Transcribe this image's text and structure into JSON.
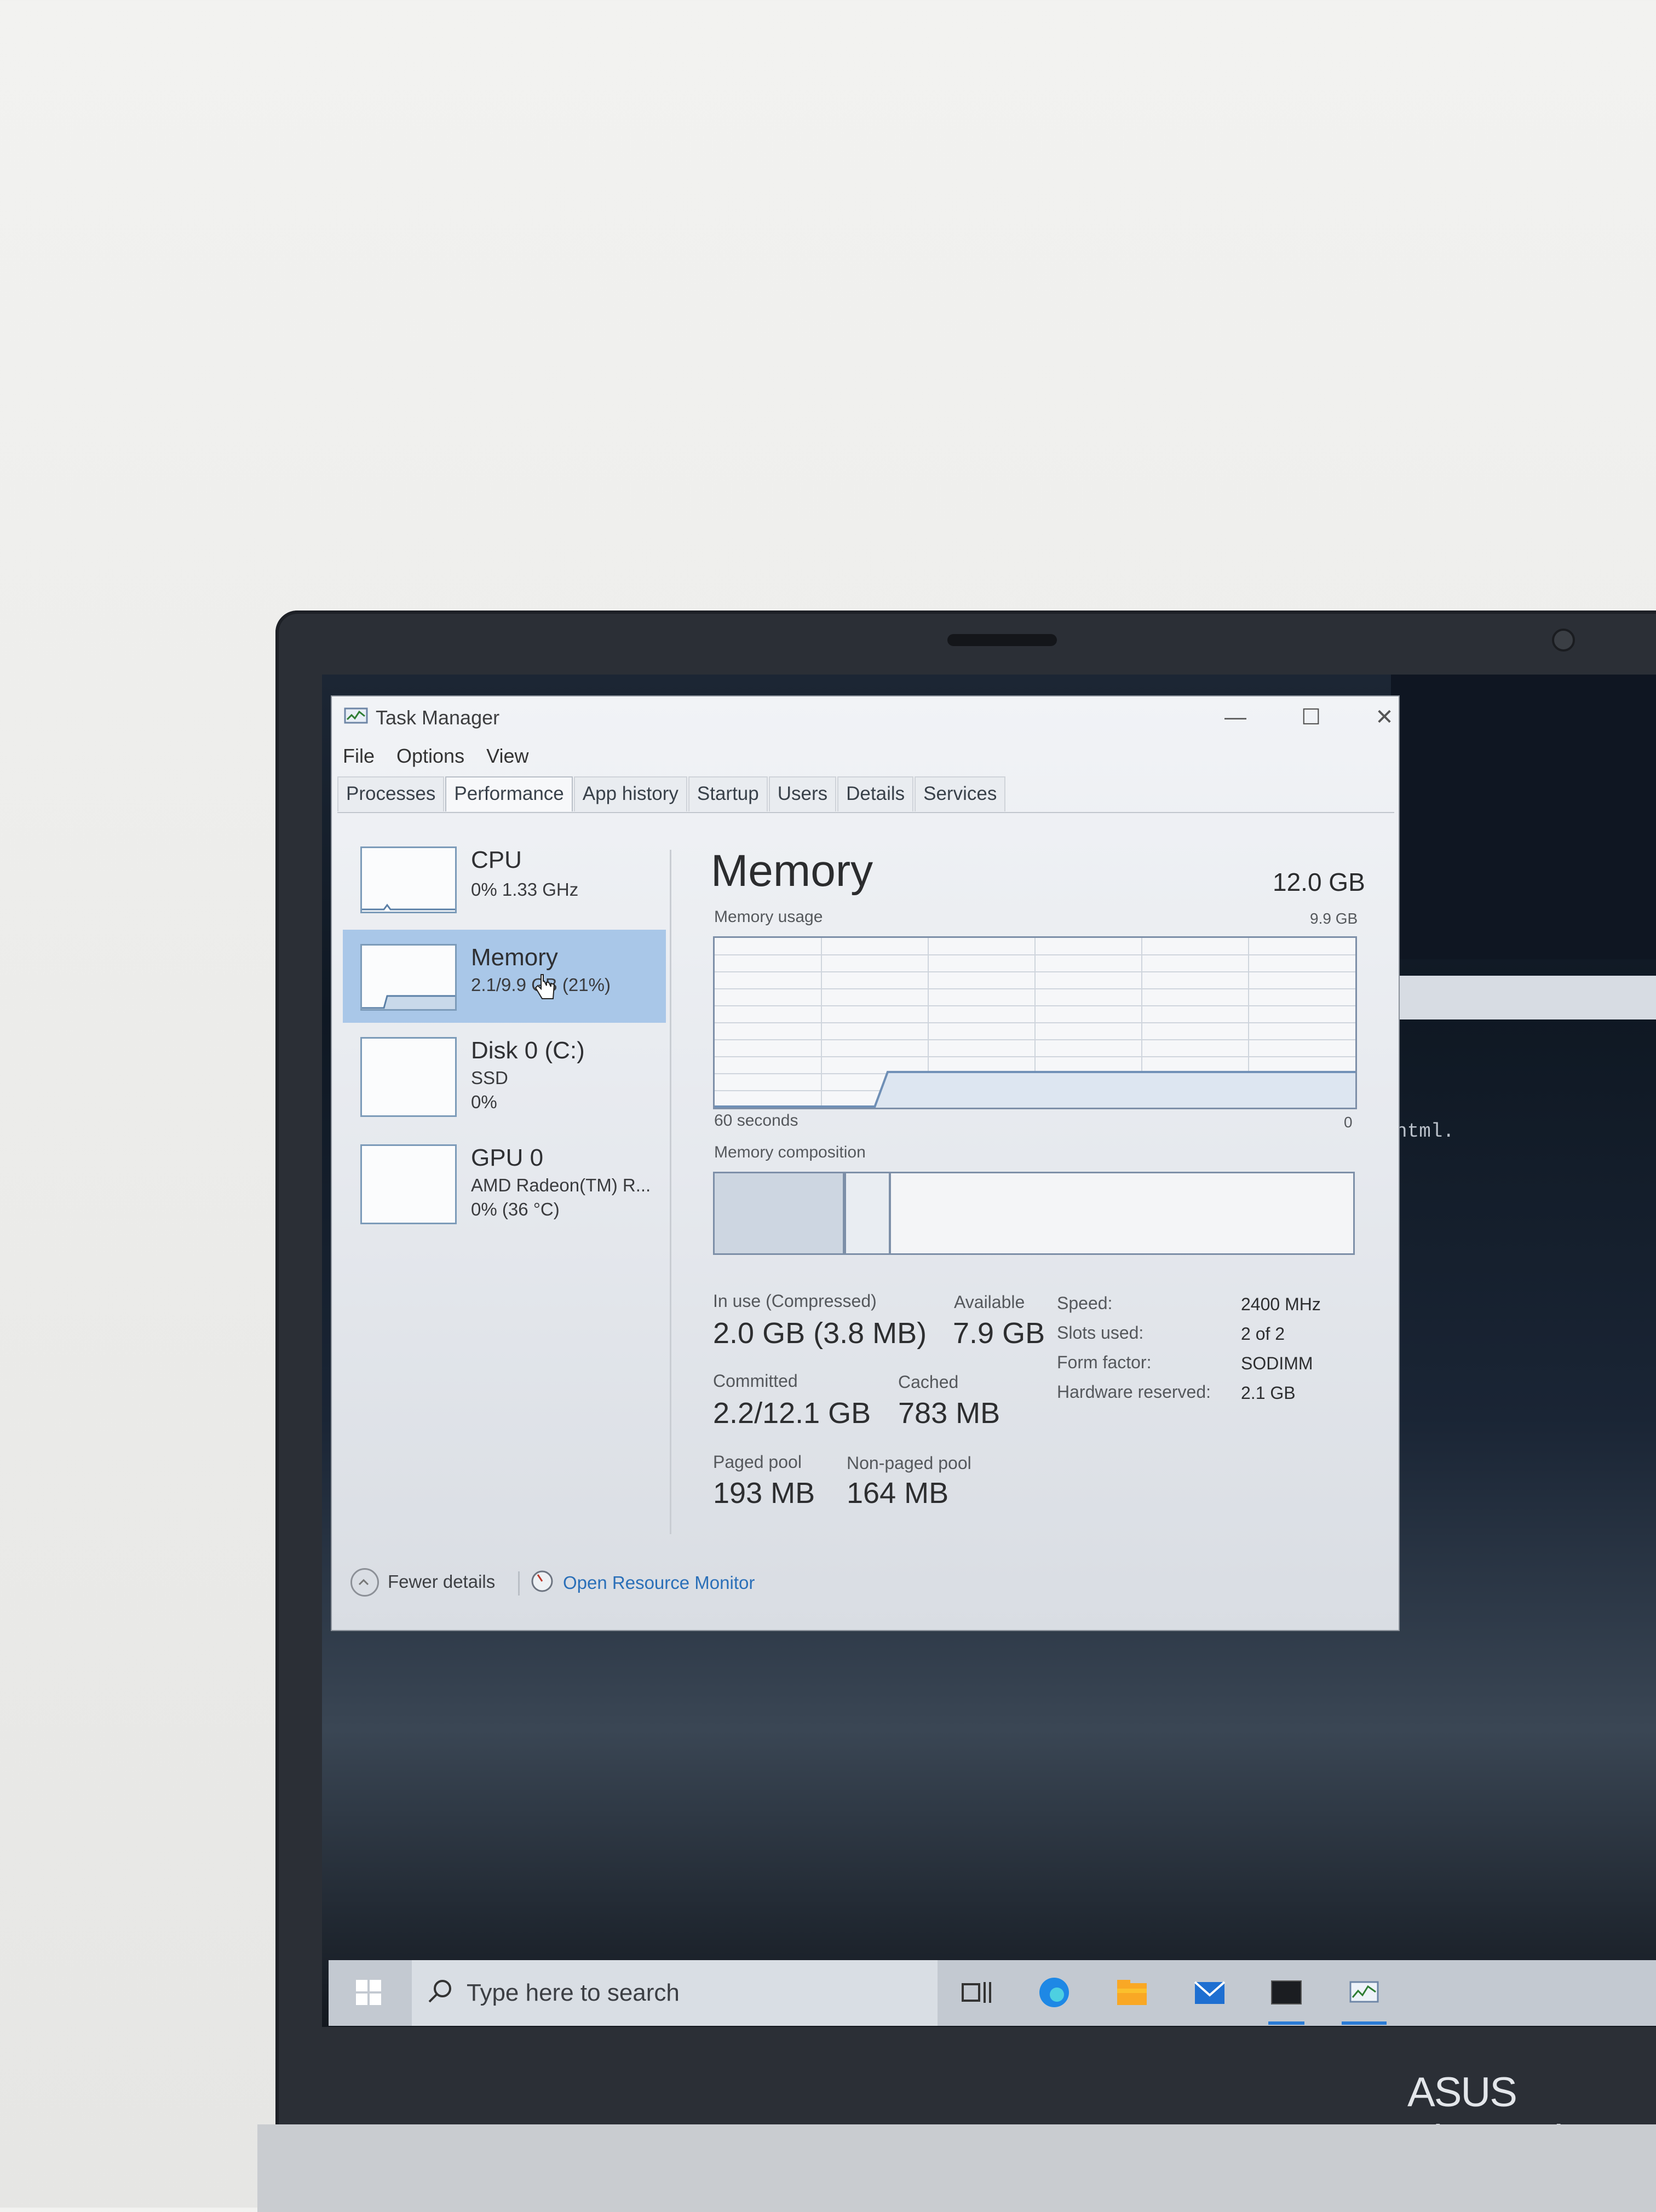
{
  "window": {
    "title": "Task Manager",
    "minimize": "—",
    "maximize": "☐",
    "close": "✕"
  },
  "menu": [
    "File",
    "Options",
    "View"
  ],
  "tabs": [
    "Processes",
    "Performance",
    "App history",
    "Startup",
    "Users",
    "Details",
    "Services"
  ],
  "active_tab": "Performance",
  "sidebar": {
    "items": [
      {
        "name": "CPU",
        "sub1": "0% 1.33 GHz",
        "sub2": "",
        "selected": false
      },
      {
        "name": "Memory",
        "sub1": "2.1/9.9 GB (21%)",
        "sub2": "",
        "selected": true
      },
      {
        "name": "Disk 0 (C:)",
        "sub1": "SSD",
        "sub2": "0%",
        "selected": false
      },
      {
        "name": "GPU 0",
        "sub1": "AMD Radeon(TM) R...",
        "sub2": "0% (36 °C)",
        "selected": false
      }
    ]
  },
  "memory": {
    "title": "Memory",
    "total": "12.0 GB",
    "usage_label": "Memory usage",
    "usage_max": "9.9 GB",
    "time_left": "60 seconds",
    "time_right": "0",
    "composition_label": "Memory composition",
    "usage_fraction": 0.21,
    "stats": {
      "in_use_label": "In use (Compressed)",
      "in_use": "2.0 GB (3.8 MB)",
      "available_label": "Available",
      "available": "7.9 GB",
      "committed_label": "Committed",
      "committed": "2.2/12.1 GB",
      "cached_label": "Cached",
      "cached": "783 MB",
      "paged_label": "Paged pool",
      "paged": "193 MB",
      "nonpaged_label": "Non-paged pool",
      "nonpaged": "164 MB"
    },
    "details": [
      {
        "label": "Speed:",
        "value": "2400 MHz"
      },
      {
        "label": "Slots used:",
        "value": "2 of 2"
      },
      {
        "label": "Form factor:",
        "value": "SODIMM"
      },
      {
        "label": "Hardware reserved:",
        "value": "2.1 GB"
      }
    ]
  },
  "footer": {
    "fewer_details": "Fewer details",
    "open_monitor": "Open Resource Monitor"
  },
  "taskbar": {
    "search_placeholder": "Type here to search"
  },
  "background": {
    "terminal_text": "html."
  },
  "device": {
    "brand": "ASUS VivoBook"
  },
  "colors": {
    "selection": "#a9c7e8",
    "graph_line": "#7d8fa8",
    "link": "#2a6fb8",
    "accent_taskbar": "#2a7bd6"
  }
}
